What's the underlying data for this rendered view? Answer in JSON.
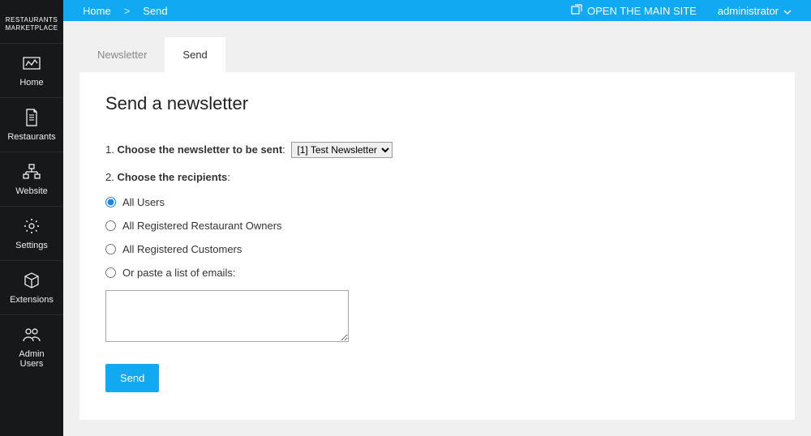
{
  "logo": {
    "line1": "RESTAURANTS",
    "line2": "MARKETPLACE"
  },
  "sidebar": {
    "items": [
      {
        "label": "Home"
      },
      {
        "label": "Restaurants"
      },
      {
        "label": "Website"
      },
      {
        "label": "Settings"
      },
      {
        "label": "Extensions"
      },
      {
        "label": "Admin\nUsers"
      }
    ]
  },
  "topbar": {
    "breadcrumb_home": "Home",
    "breadcrumb_sep": ">",
    "breadcrumb_current": "Send",
    "open_site_label": "OPEN THE MAIN SITE",
    "user_label": "administrator"
  },
  "tabs": {
    "newsletter": "Newsletter",
    "send": "Send"
  },
  "page": {
    "title": "Send a newsletter",
    "step1_prefix": "1. ",
    "step1_bold": "Choose the newsletter to be sent",
    "step1_colon": ": ",
    "select_value": "[1] Test Newsletter",
    "step2_prefix": "2. ",
    "step2_bold": "Choose the recipients",
    "step2_colon": ":",
    "radio_all": "All Users",
    "radio_owners": "All Registered Restaurant Owners",
    "radio_customers": "All Registered Customers",
    "radio_paste": "Or paste a list of emails:",
    "send_btn": "Send"
  }
}
